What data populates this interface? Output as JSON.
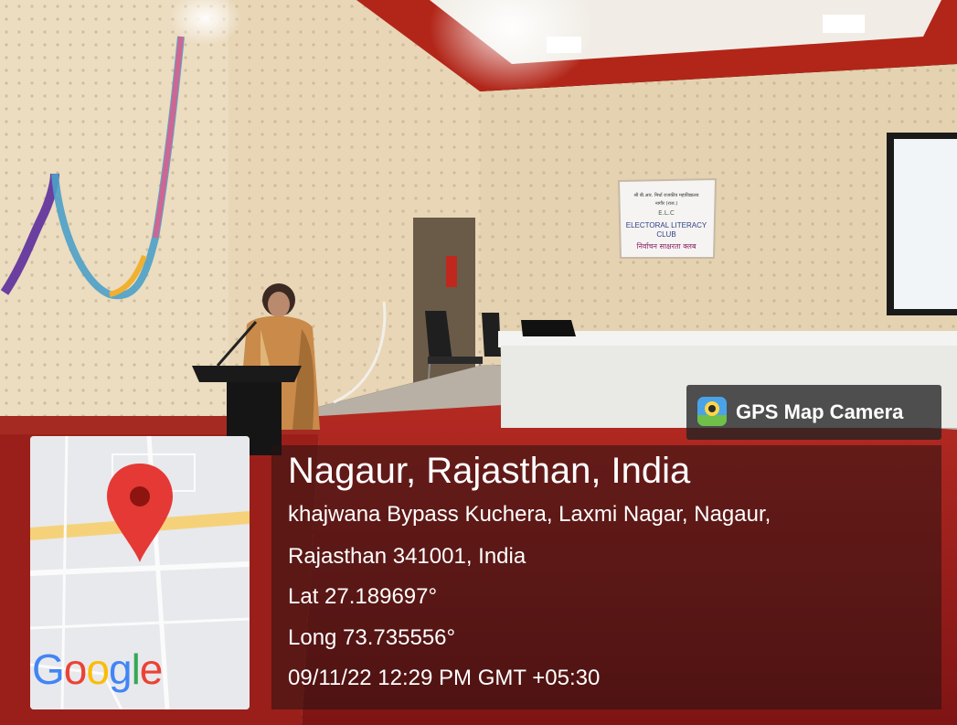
{
  "badge": {
    "label": "GPS Map Camera",
    "icon": "camera-pin-icon"
  },
  "location": {
    "title": "Nagaur, Rajasthan, India",
    "address_line1": "khajwana Bypass Kuchera, Laxmi Nagar, Nagaur,",
    "address_line2": "Rajasthan 341001, India",
    "lat": "Lat 27.189697°",
    "long": "Long 73.735556°",
    "timestamp": "09/11/22 12:29 PM GMT +05:30"
  },
  "map": {
    "logo": "Google",
    "pin_color": "#e53935"
  },
  "banner": {
    "line1": "श्री बी.आर. मिर्धा राजकीय महाविद्यालय",
    "line2": "नागौर (राज.)",
    "line3": "E.L.C",
    "line4": "ELECTORAL LITERACY",
    "line5": "CLUB",
    "line6": "निर्वाचन साक्षरता क्लब"
  },
  "colors": {
    "carpet": "#9c1c1c",
    "wall": "#e6d6b8",
    "ceiling": "#b5271c",
    "panel": "rgba(40,18,18,0.55)"
  }
}
